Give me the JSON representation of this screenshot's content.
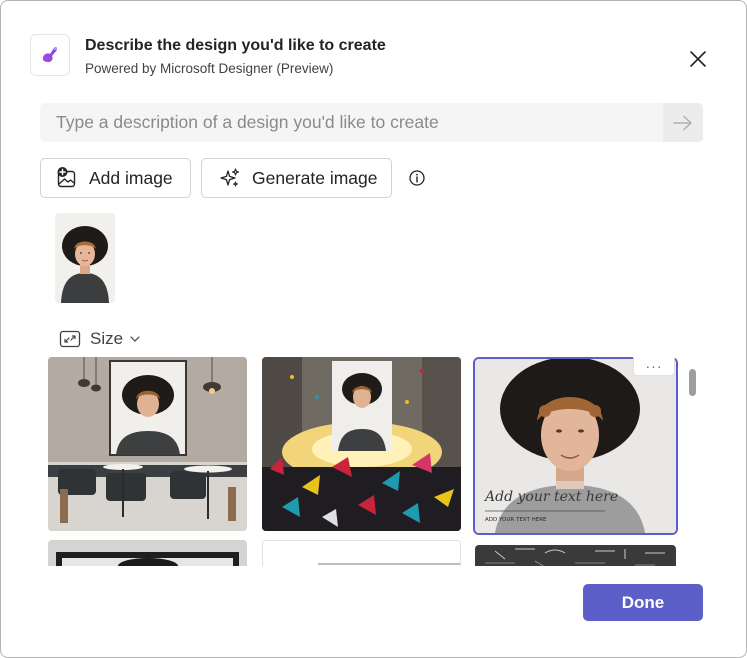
{
  "dialog": {
    "title": "Describe the design you'd like to create",
    "subtitle": "Powered by Microsoft Designer (Preview)",
    "close_icon": "close-icon",
    "logo_icon": "designer-logo-icon"
  },
  "prompt": {
    "value": "",
    "placeholder": "Type a description of a design you'd like to create",
    "submit_icon": "arrow-right-icon"
  },
  "actions": {
    "add_image_label": "Add image",
    "add_image_icon": "image-add-icon",
    "generate_image_label": "Generate image",
    "generate_image_icon": "sparkle-icon",
    "info_icon": "info-icon"
  },
  "size": {
    "label": "Size",
    "icon": "resize-icon",
    "chevron_icon": "chevron-down-icon"
  },
  "gallery": {
    "design_text_script": "Add your text here",
    "design_text_caption": "ADD YOUR TEXT HERE",
    "more_label": "···"
  },
  "footer": {
    "done_label": "Done"
  },
  "colors": {
    "accent": "#5b5fc7",
    "selected_border": "#5b5fc7"
  }
}
